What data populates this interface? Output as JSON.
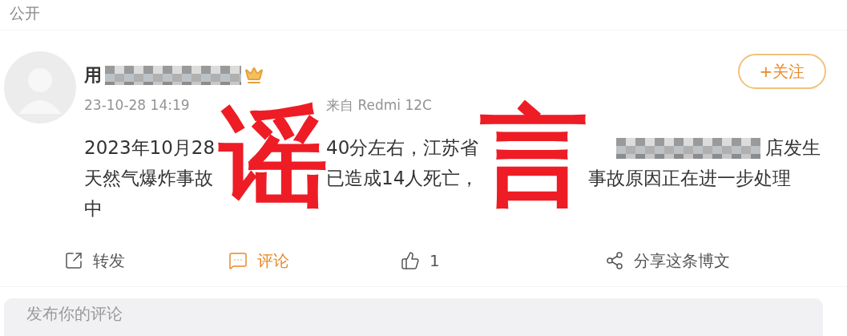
{
  "visibility": "公开",
  "author": {
    "name": "用",
    "redacted": true,
    "vip": true
  },
  "follow_button": {
    "label": "+关注"
  },
  "meta": [
    "23-10-28 14:19",
    "来自 Redmi 12C"
  ],
  "body_lines": [
    [
      {
        "text": "2023年10月28",
        "redacted_before": false
      },
      {
        "text": "40分左右，江苏省",
        "redacted_before": false
      },
      {
        "text": "店发生",
        "redacted_before": true
      }
    ],
    [
      {
        "text": "天然气爆炸事故",
        "redacted_before": false
      },
      {
        "text": "已造成14人死亡，",
        "redacted_before": false
      },
      {
        "text": "事故原因正在进一步处理",
        "redacted_before": false
      }
    ],
    [
      {
        "text": "中",
        "redacted_before": false
      }
    ]
  ],
  "stamp": {
    "characters": [
      "谣",
      "言"
    ]
  },
  "actions": [
    {
      "kind": "repost",
      "label": "转发",
      "selected": false
    },
    {
      "kind": "comment",
      "label": "评论",
      "selected": true
    },
    {
      "kind": "like",
      "label": "1",
      "selected": false
    },
    {
      "kind": "share",
      "label": "分享这条博文",
      "selected": false
    }
  ],
  "comment_box": {
    "placeholder": "发布你的评论"
  }
}
